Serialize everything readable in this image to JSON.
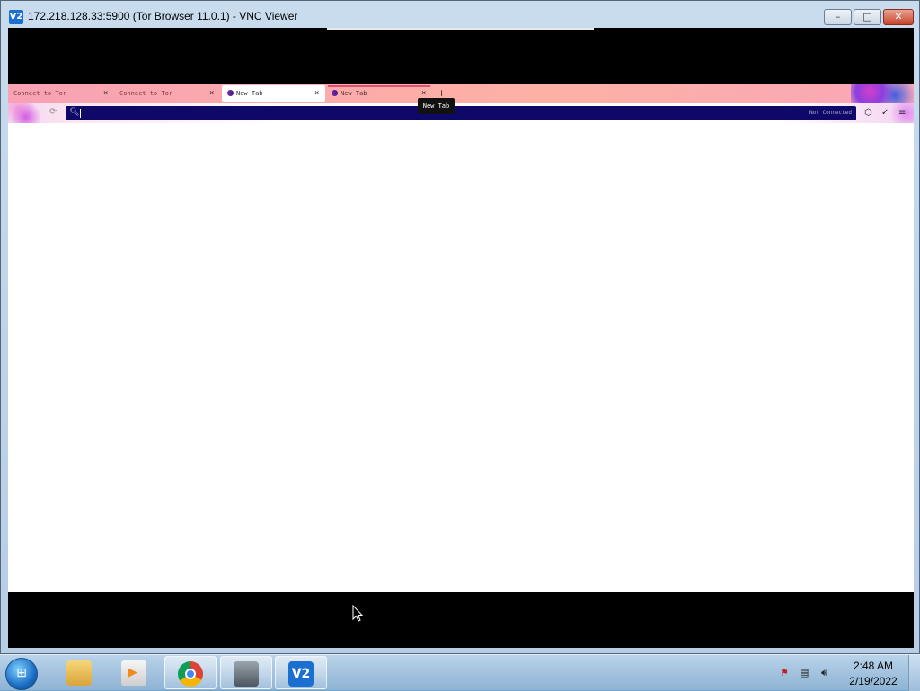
{
  "window": {
    "title": "172.218.128.33:5900 (Tor Browser 11.0.1) - VNC Viewer",
    "logo_text": "V2",
    "controls": {
      "minimize": "–",
      "maximize": "□",
      "close": "✕"
    }
  },
  "browser": {
    "tabs": [
      {
        "label": "Connect to Tor",
        "close": "×"
      },
      {
        "label": "Connect to Tor",
        "close": "×"
      },
      {
        "label": "New Tab",
        "close": "×",
        "active": true
      },
      {
        "label": "New Tab",
        "close": "×"
      }
    ],
    "new_tab_button": "+",
    "tooltip": "New Tab",
    "url_bar": {
      "value": "",
      "status": "Not Connected"
    }
  },
  "taskbar": {
    "clock_time": "2:48 AM",
    "clock_date": "2/19/2022",
    "vnc_label": "V2",
    "start_glyph": "⊞"
  }
}
